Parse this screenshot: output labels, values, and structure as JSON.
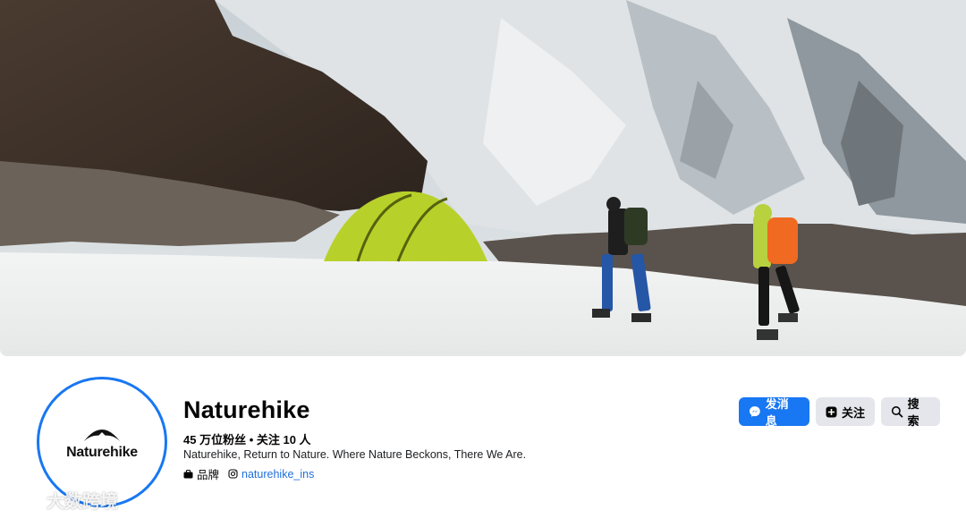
{
  "profile": {
    "name": "Naturehike",
    "followers_text": "45 万位粉丝",
    "separator": " • ",
    "following_text": "关注 10 人",
    "bio": "Naturehike, Return to Nature. Where Nature Beckons, There We Are.",
    "category": "品牌",
    "instagram_handle": "naturehike_ins",
    "avatar_logo_text": "Naturehike"
  },
  "actions": {
    "message_label": "发消息",
    "follow_label": "关注",
    "search_label": "搜索"
  },
  "watermark": {
    "text": "大数跨境"
  },
  "cover": {
    "description_icons": [
      "mountain",
      "tent",
      "hikers"
    ]
  },
  "colors": {
    "accent": "#1877f2",
    "secondary_button": "#e4e6eb",
    "link": "#216fdb"
  }
}
